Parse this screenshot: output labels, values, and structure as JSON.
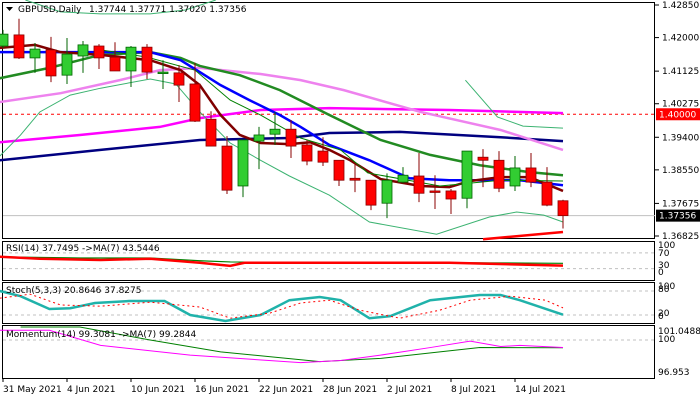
{
  "header": {
    "symbol": "GBPUSD,Daily",
    "ohlc": "1.37744 1.37771 1.37020 1.37356"
  },
  "price_axis": {
    "ticks": [
      "1.42850",
      "1.42000",
      "1.41125",
      "1.40275",
      "1.39400",
      "1.38550",
      "1.37675",
      "1.36825"
    ],
    "tick_values": [
      1.4285,
      1.42,
      1.41125,
      1.40275,
      1.394,
      1.3855,
      1.37675,
      1.36825
    ],
    "level_label": "1.40000",
    "level_value": 1.4,
    "level_color": "#ff0000",
    "current_label": "1.37356",
    "current_value": 1.37356
  },
  "rsi": {
    "label": "RSI(14) 37.7495  ->MA(7) 43.5446",
    "ticks": [
      "100",
      "70",
      "30",
      "0"
    ],
    "rsi": [
      [
        -0.2,
        60
      ],
      [
        2.3,
        55
      ],
      [
        6.1,
        52
      ],
      [
        9.2,
        55
      ],
      [
        12.3,
        45
      ],
      [
        14.2,
        37
      ],
      [
        15.1,
        45
      ],
      [
        20.4,
        45
      ],
      [
        27.9,
        45
      ],
      [
        35,
        37.7
      ]
    ],
    "ma": [
      [
        -0.2,
        60
      ],
      [
        4.8,
        57
      ],
      [
        9.2,
        57
      ],
      [
        12.3,
        50
      ],
      [
        14.2,
        47
      ],
      [
        20.4,
        45
      ],
      [
        27.9,
        45
      ],
      [
        35,
        43.5
      ]
    ]
  },
  "stoch": {
    "label": "Stoch(5,3,3) 20.8646 37.8275",
    "ticks": [
      "100",
      "80",
      "20",
      "0"
    ],
    "main": [
      [
        -0.2,
        80
      ],
      [
        1.1,
        67
      ],
      [
        2.9,
        35
      ],
      [
        4.2,
        37
      ],
      [
        5.75,
        50
      ],
      [
        7.9,
        55
      ],
      [
        10.1,
        55
      ],
      [
        11.7,
        20
      ],
      [
        13.9,
        5
      ],
      [
        16.1,
        20
      ],
      [
        17.9,
        57
      ],
      [
        19.8,
        65
      ],
      [
        21.1,
        57
      ],
      [
        22.9,
        12
      ],
      [
        24.2,
        17
      ],
      [
        26.7,
        57
      ],
      [
        29.8,
        70
      ],
      [
        31.1,
        70
      ],
      [
        32.3,
        57
      ],
      [
        35,
        20.9
      ]
    ],
    "signal": [
      [
        -0.2,
        62
      ],
      [
        1.7,
        72
      ],
      [
        3.6,
        45
      ],
      [
        6.1,
        42
      ],
      [
        9.2,
        52
      ],
      [
        12.3,
        40
      ],
      [
        14.2,
        12
      ],
      [
        16.7,
        25
      ],
      [
        18.6,
        50
      ],
      [
        20.4,
        57
      ],
      [
        22.3,
        32
      ],
      [
        24.8,
        12
      ],
      [
        27.3,
        32
      ],
      [
        29.2,
        57
      ],
      [
        31.7,
        67
      ],
      [
        33.9,
        57
      ],
      [
        35,
        37.8
      ]
    ]
  },
  "momentum": {
    "label": "Momentum(14) 99.3081  ->MA(7) 99.2844",
    "ticks": [
      "101.0488",
      "100",
      "96.953"
    ],
    "mom": [
      [
        -0.2,
        100.9
      ],
      [
        2.9,
        100.9
      ],
      [
        6.1,
        99.5
      ],
      [
        11.7,
        98.6
      ],
      [
        18.6,
        97.9
      ],
      [
        21.1,
        98.1
      ],
      [
        23.6,
        98.6
      ],
      [
        26.7,
        99.3
      ],
      [
        29.2,
        99.9
      ],
      [
        31.1,
        99.4
      ],
      [
        32.3,
        99.5
      ],
      [
        35,
        99.3
      ]
    ],
    "ma": [
      [
        1.1,
        101.2
      ],
      [
        4.8,
        101.2
      ],
      [
        9.2,
        100
      ],
      [
        13.6,
        98.9
      ],
      [
        19.8,
        98.0
      ],
      [
        23.6,
        98.3
      ],
      [
        27.3,
        98.9
      ],
      [
        29.8,
        99.3
      ],
      [
        35,
        99.28
      ]
    ]
  },
  "dates": [
    {
      "label": "31 May 2021",
      "idx": 0
    },
    {
      "label": "4 Jun 2021",
      "idx": 4
    },
    {
      "label": "10 Jun 2021",
      "idx": 8
    },
    {
      "label": "16 Jun 2021",
      "idx": 12
    },
    {
      "label": "22 Jun 2021",
      "idx": 16
    },
    {
      "label": "28 Jun 2021",
      "idx": 20
    },
    {
      "label": "2 Jul 2021",
      "idx": 24
    },
    {
      "label": "8 Jul 2021",
      "idx": 28
    },
    {
      "label": "14 Jul 2021",
      "idx": 32
    }
  ],
  "chart_data": {
    "type": "candlestick",
    "title": "GBPUSD,Daily",
    "ylim": [
      1.36825,
      1.4285
    ],
    "candles": [
      [
        1.4178,
        1.422,
        1.4173,
        1.4209
      ],
      [
        1.4207,
        1.4249,
        1.4144,
        1.4147
      ],
      [
        1.4147,
        1.4186,
        1.4108,
        1.417
      ],
      [
        1.4168,
        1.4202,
        1.4084,
        1.41
      ],
      [
        1.4102,
        1.4199,
        1.4079,
        1.4157
      ],
      [
        1.4152,
        1.4191,
        1.4108,
        1.4181
      ],
      [
        1.4178,
        1.4183,
        1.4118,
        1.4147
      ],
      [
        1.4149,
        1.4188,
        1.4113,
        1.4113
      ],
      [
        1.4113,
        1.4178,
        1.4071,
        1.4175
      ],
      [
        1.4175,
        1.4183,
        1.4092,
        1.411
      ],
      [
        1.4108,
        1.4141,
        1.4066,
        1.411
      ],
      [
        1.4108,
        1.4128,
        1.4032,
        1.4076
      ],
      [
        1.4079,
        1.4134,
        1.398,
        1.3982
      ],
      [
        1.3987,
        1.4008,
        1.3917,
        1.3917
      ],
      [
        1.3917,
        1.3943,
        1.3792,
        1.3802
      ],
      [
        1.3813,
        1.3933,
        1.3784,
        1.3933
      ],
      [
        1.393,
        1.3967,
        1.3857,
        1.3946
      ],
      [
        1.3948,
        1.4006,
        1.392,
        1.3961
      ],
      [
        1.3961,
        1.3985,
        1.3886,
        1.3917
      ],
      [
        1.392,
        1.3933,
        1.3867,
        1.3878
      ],
      [
        1.3904,
        1.394,
        1.3865,
        1.3875
      ],
      [
        1.388,
        1.388,
        1.3813,
        1.3828
      ],
      [
        1.3833,
        1.3873,
        1.3797,
        1.3828
      ],
      [
        1.3828,
        1.3828,
        1.375,
        1.3763
      ],
      [
        1.3768,
        1.3846,
        1.3729,
        1.3828
      ],
      [
        1.3823,
        1.3862,
        1.382,
        1.3841
      ],
      [
        1.3839,
        1.3899,
        1.3771,
        1.3794
      ],
      [
        1.38,
        1.3841,
        1.3753,
        1.3799
      ],
      [
        1.38,
        1.3805,
        1.374,
        1.3779
      ],
      [
        1.3781,
        1.3904,
        1.3755,
        1.3904
      ],
      [
        1.3888,
        1.3909,
        1.381,
        1.388
      ],
      [
        1.388,
        1.3904,
        1.3797,
        1.3807
      ],
      [
        1.3813,
        1.3891,
        1.38,
        1.386
      ],
      [
        1.386,
        1.3899,
        1.381,
        1.3823
      ],
      [
        1.3823,
        1.3862,
        1.376,
        1.3763
      ],
      [
        1.37744,
        1.37771,
        1.3702,
        1.37356
      ]
    ],
    "lines": [
      {
        "name": "ma-navy",
        "color": "#000080",
        "width": 2.5,
        "points": [
          [
            -0.2,
            1.388
          ],
          [
            6.1,
            1.3907
          ],
          [
            12.3,
            1.3933
          ],
          [
            17.9,
            1.3938
          ],
          [
            20.4,
            1.3951
          ],
          [
            24.8,
            1.3954
          ],
          [
            31.1,
            1.394
          ],
          [
            35,
            1.393
          ]
        ]
      },
      {
        "name": "ma-magenta",
        "color": "#ff00ff",
        "width": 2.5,
        "points": [
          [
            -0.2,
            1.3927
          ],
          [
            4.8,
            1.3946
          ],
          [
            9.8,
            1.3967
          ],
          [
            12.3,
            1.399
          ],
          [
            16.1,
            1.4011
          ],
          [
            20.4,
            1.4016
          ],
          [
            27.9,
            1.4011
          ],
          [
            35,
            1.4003
          ]
        ]
      },
      {
        "name": "ma-violet",
        "color": "#ee82ee",
        "width": 2.5,
        "points": [
          [
            -0.2,
            1.4032
          ],
          [
            3.6,
            1.4055
          ],
          [
            7.3,
            1.4089
          ],
          [
            9.8,
            1.4115
          ],
          [
            12.3,
            1.4121
          ],
          [
            16.1,
            1.4105
          ],
          [
            18.6,
            1.4089
          ],
          [
            21.3,
            1.4063
          ],
          [
            26.1,
            1.4006
          ],
          [
            31.1,
            1.3959
          ],
          [
            35,
            1.3907
          ]
        ]
      },
      {
        "name": "ma-green",
        "color": "#228b22",
        "width": 2.5,
        "points": [
          [
            -0.2,
            1.4094
          ],
          [
            2.9,
            1.4121
          ],
          [
            6.1,
            1.4155
          ],
          [
            9.2,
            1.4162
          ],
          [
            11.1,
            1.4147
          ],
          [
            12.3,
            1.4126
          ],
          [
            14.8,
            1.4102
          ],
          [
            17.3,
            1.4063
          ],
          [
            20.4,
            1.3998
          ],
          [
            23.6,
            1.3933
          ],
          [
            26.7,
            1.3894
          ],
          [
            29.8,
            1.3867
          ],
          [
            32.9,
            1.3849
          ],
          [
            35,
            1.3841
          ]
        ]
      },
      {
        "name": "ma-blue",
        "color": "#0000ff",
        "width": 2.5,
        "points": [
          [
            -0.2,
            1.4162
          ],
          [
            9.2,
            1.4162
          ],
          [
            11.1,
            1.4141
          ],
          [
            12.3,
            1.411
          ],
          [
            13.6,
            1.4076
          ],
          [
            15.4,
            1.4037
          ],
          [
            17.3,
            1.3998
          ],
          [
            18.6,
            1.3967
          ],
          [
            20.4,
            1.392
          ],
          [
            22.9,
            1.388
          ],
          [
            25.4,
            1.3833
          ],
          [
            27.9,
            1.3828
          ],
          [
            32.3,
            1.3828
          ],
          [
            35,
            1.3815
          ]
        ]
      },
      {
        "name": "ma-darkred",
        "color": "#800000",
        "width": 2.5,
        "points": [
          [
            -0.2,
            1.4173
          ],
          [
            2,
            1.4181
          ],
          [
            3.6,
            1.4162
          ],
          [
            6.1,
            1.4155
          ],
          [
            9.2,
            1.4141
          ],
          [
            11.1,
            1.4115
          ],
          [
            12.3,
            1.4076
          ],
          [
            13.6,
            1.3998
          ],
          [
            14.8,
            1.3946
          ],
          [
            16.1,
            1.3925
          ],
          [
            17.9,
            1.3922
          ],
          [
            19.2,
            1.3927
          ],
          [
            20.4,
            1.3907
          ],
          [
            21.7,
            1.388
          ],
          [
            23.6,
            1.3831
          ],
          [
            26.1,
            1.3813
          ],
          [
            27.9,
            1.381
          ],
          [
            29.2,
            1.3826
          ],
          [
            31.1,
            1.3836
          ],
          [
            32.9,
            1.3836
          ],
          [
            35,
            1.38
          ]
        ]
      },
      {
        "name": "bollinger-upper-a",
        "color": "#3cb371",
        "width": 1,
        "points": [
          [
            1.4,
            1.4298
          ],
          [
            3.6,
            1.4267
          ],
          [
            6.1,
            1.4262
          ],
          [
            9.2,
            1.4262
          ],
          [
            11.4,
            1.4272
          ],
          [
            13.3,
            1.4298
          ]
        ]
      },
      {
        "name": "bollinger-upper-b",
        "color": "#3cb371",
        "width": 1,
        "points": [
          [
            28.9,
            1.4089
          ],
          [
            30.9,
            1.3993
          ],
          [
            32.5,
            1.3969
          ],
          [
            35,
            1.3964
          ]
        ]
      },
      {
        "name": "bollinger-lower",
        "color": "#3cb371",
        "width": 1,
        "points": [
          [
            -0.2,
            1.3891
          ],
          [
            1.1,
            1.3946
          ],
          [
            2.3,
            1.4006
          ],
          [
            4.2,
            1.405
          ],
          [
            6.1,
            1.4068
          ],
          [
            9.2,
            1.4092
          ],
          [
            10.8,
            1.4079
          ],
          [
            12.3,
            1.4006
          ],
          [
            14.2,
            1.3925
          ],
          [
            16.1,
            1.388
          ],
          [
            17.9,
            1.3839
          ],
          [
            20.4,
            1.3789
          ],
          [
            22.9,
            1.3719
          ],
          [
            27.1,
            1.3687
          ],
          [
            30.4,
            1.3732
          ],
          [
            32.1,
            1.3745
          ],
          [
            33.8,
            1.3737
          ],
          [
            35,
            1.3719
          ]
        ]
      },
      {
        "name": "bollinger-middle",
        "color": "#008000",
        "width": 1,
        "points": [
          [
            6.1,
            1.4168
          ],
          [
            9,
            1.4149
          ],
          [
            12,
            1.4115
          ],
          [
            14.2,
            1.4037
          ],
          [
            16.1,
            1.3998
          ],
          [
            18.6,
            1.3938
          ],
          [
            21.1,
            1.3907
          ],
          [
            22.8,
            1.3847
          ],
          [
            27.3,
            1.3813
          ],
          [
            31.1,
            1.3828
          ],
          [
            35,
            1.3826
          ]
        ]
      },
      {
        "name": "ma-red-low",
        "color": "#ff0000",
        "width": 2.5,
        "points": [
          [
            30,
            1.3674
          ],
          [
            35,
            1.3693
          ]
        ]
      }
    ]
  }
}
